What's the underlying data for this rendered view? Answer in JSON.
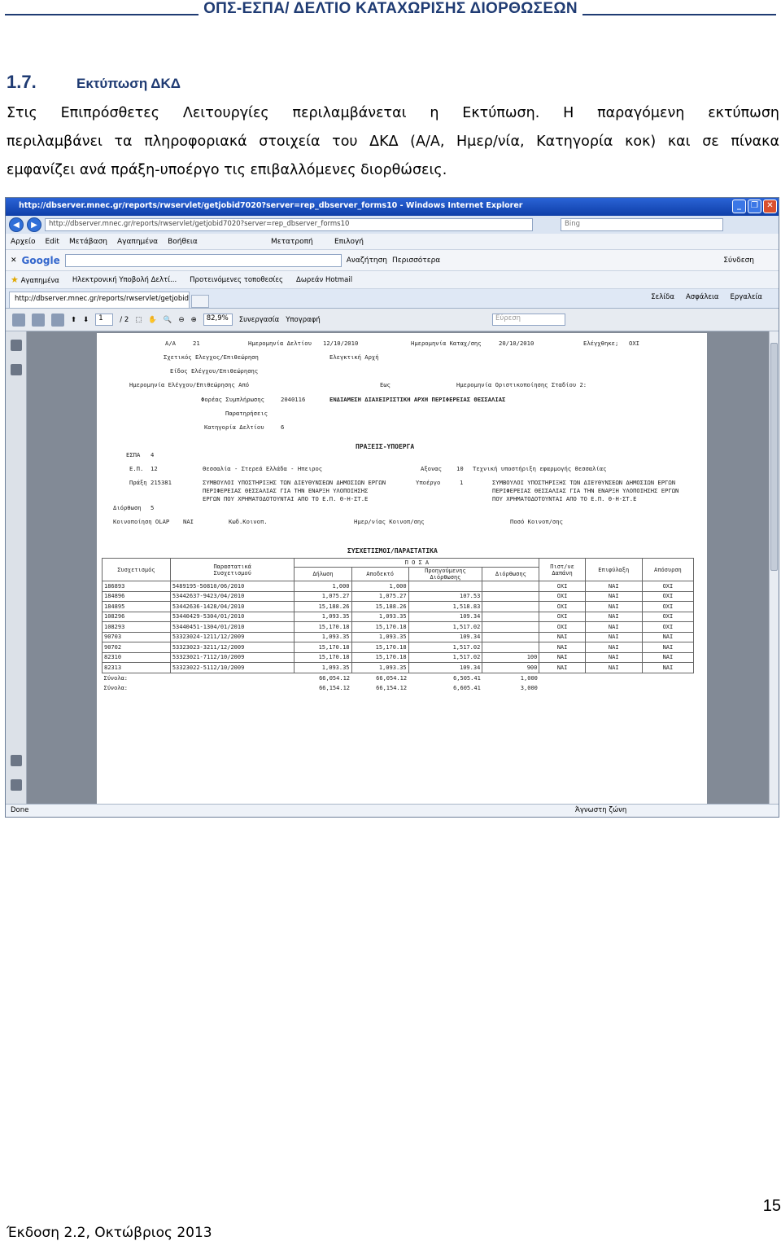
{
  "header": {
    "title": "ΟΠΣ-ΕΣΠΑ/ ΔΕΛΤΙΟ ΚΑΤΑΧΩΡΙΣΗΣ ΔΙΟΡΘΩΣΕΩΝ"
  },
  "section": {
    "number": "1.7.",
    "title": "Εκτύπωση ΔΚΔ"
  },
  "paragraph": {
    "line1": "Στις Επιπρόσθετες Λειτουργίες περιλαμβάνεται η Εκτύπωση. Η παραγόμενη εκτύπωση",
    "line2": "περιλαμβάνει τα πληροφοριακά στοιχεία του ΔΚΔ (Α/Α, Ημερ/νία, Κατηγορία κοκ) και σε πίνακα",
    "line3": "εμφανίζει ανά πράξη-υποέργο τις επιβαλλόμενες διορθώσεις."
  },
  "browser": {
    "window_title": "http://dbserver.mnec.gr/reports/rwservlet/getjobid7020?server=rep_dbserver_forms10 - Windows Internet Explorer",
    "address": "http://dbserver.mnec.gr/reports/rwservlet/getjobid7020?server=rep_dbserver_forms10",
    "search_placeholder": "Bing",
    "menu": [
      "Αρχείο",
      "Edit",
      "Μετάβαση",
      "Αγαπημένα",
      "Βοήθεια"
    ],
    "menu_right": [
      "Μετατροπή",
      "Επιλογή"
    ],
    "google_label": "Google",
    "google_buttons": [
      "Αναζήτηση",
      "Περισσότερα"
    ],
    "google_signin": "Σύνδεση",
    "favorites": [
      "Αγαπημένα",
      "Ηλεκτρονική Υποβολή Δελτί...",
      "Προτεινόμενες τοποθεσίες",
      "Δωρεάν Hotmail"
    ],
    "tab_label": "http://dbserver.mnec.gr/reports/rwservlet/getjobid7...",
    "command_bar": [
      "Σελίδα",
      "Ασφάλεια",
      "Εργαλεία"
    ],
    "pdf_page_current": "1",
    "pdf_page_total": "/ 2",
    "pdf_zoom": "82,9%",
    "pdf_collab": "Συνεργασία",
    "pdf_sign": "Υπογραφή",
    "pdf_find": "Εύρεση",
    "status_left": "Done",
    "status_zone": "Άγνωστη ζώνη"
  },
  "report": {
    "aa_label": "Α/Α",
    "aa_value": "21",
    "date_label": "Ημερομηνία Δελτίου",
    "date_value": "12/10/2010",
    "entry_date_label": "Ημερομηνία Καταχ/σης",
    "entry_date_value": "20/10/2010",
    "checked_label": "Ελέγχθηκε;",
    "checked_value": "ΟΧΙ",
    "related_check_label": "Σχετικός Ελεγχος/Επιθεώρηση",
    "audit_authority_label": "Ελεγκτική Αρχή",
    "check_type_label": "Είδος Ελέγχου/Επιθεώρησης",
    "check_date_label": "Ημερομηνία Ελέγχου/Επιθεώρησης Από",
    "to_label": "Εως",
    "final_date_label": "Ημερομηνία Οριστικοποίησης Σταδίου 2:",
    "body_label": "Φορέας Συμπλήρωσης",
    "body_value": "2040116",
    "body_name": "ΕΝΔΙΑΜΕΣΗ ΔΙΑΧΕΙΡΙΣΤΙΚΗ ΑΡΧΗ ΠΕΡΙΦΕΡΕΙΑΣ ΘΕΣΣΑΛΙΑΣ",
    "remarks_label": "Παρατηρήσεις",
    "category_label": "Κατηγορία Δελτίου",
    "category_value": "6",
    "projects_title": "ΠΡΑΞΕΙΣ-ΥΠΟΕΡΓΑ",
    "espa_label": "ΕΣΠΑ",
    "espa_value": "4",
    "ep_label": "Ε.Π.",
    "ep_value": "12",
    "ep_name": "Θεσσαλία - Στερεά Ελλάδα - Ηπειρος",
    "axis_label": "Αξονας",
    "axis_value": "10",
    "axis_name": "Τεχνική υποστήριξη εφαρμογής Θεσσαλίας",
    "project_label": "Πράξη",
    "project_value": "215381",
    "project_name_1": "ΣΥΜΒΟΥΛΟΙ ΥΠΟΣΤΗΡΙΞΗΣ ΤΩΝ ΔΙΕΥΘΥΝΣΕΩΝ ΔΗΜΟΣΙΩΝ ΕΡΓΩΝ",
    "project_name_2": "ΠΕΡΙΦΕΡΕΙΑΣ ΘΕΣΣΑΛΙΑΣ ΓΙΑ ΤΗΝ ΕΝΑΡΞΗ ΥΛΟΠΟΙΗΣΗΣ",
    "project_name_3": "ΕΡΓΩΝ ΠΟΥ ΧΡΗΜΑΤΟΔΟΤΟΥΝΤΑΙ ΑΠΟ ΤΟ Ε.Π. Θ-Η-ΣΤ.Ε",
    "subproject_label": "Υποέργο",
    "subproject_value": "1",
    "subproject_name_1": "ΣΥΜΒΟΥΛΟΙ ΥΠΟΣΤΗΡΙΞΗΣ ΤΩΝ ΔΙΕΥΘΥΝΣΕΩΝ ΔΗΜΟΣΙΩΝ ΕΡΓΩΝ",
    "subproject_name_2": "ΠΕΡΙΦΕΡΕΙΑΣ ΘΕΣΣΑΛΙΑΣ ΓΙΑ ΤΗΝ ΕΝΑΡΞΗ ΥΛΟΠΟΙΗΣΗΣ ΕΡΓΩΝ",
    "subproject_name_3": "ΠΟΥ ΧΡΗΜΑΤΟΔΟΤΟΥΝΤΑΙ ΑΠΟ ΤΟ Ε.Π. Θ-Η-ΣΤ.Ε",
    "correction_label": "Διόρθωση",
    "correction_value": "5",
    "olap_label": "Κοινοποίηση OLAP",
    "olap_value": "ΝΑΙ",
    "code_label": "Κωδ.Κοινοπ.",
    "notify_date_label": "Ημερ/νίας Κοινοπ/σης",
    "notify_amount_label": "Ποσό Κοινοπ/σης",
    "related_title": "ΣΥΣΧΕΤΙΣΜΟΙ/ΠΑΡΑΣΤΑΤΙΚΑ",
    "table": {
      "headers": {
        "related": "Συσχετισμός",
        "docs_1": "Παραστατικά",
        "docs_2": "Συσχετισμού",
        "amounts": "Π Ο Σ Α",
        "declaration": "Δήλωση",
        "accepted": "Αποδεκτό",
        "previous_1": "Προηγούμενης",
        "previous_2": "Διόρθωσης",
        "correction": "Διόρθωσης",
        "cert_1": "Πιστ/νε",
        "cert_2": "Δαπάνη",
        "reserved": "Επιφύλαξη",
        "withdrawal": "Απόσυρση"
      },
      "rows": [
        [
          "186893",
          "5489195-50810/06/2010",
          "1,000",
          "1,000",
          "",
          "",
          "ΟΧΙ",
          "ΝΑΙ",
          "ΟΧΙ"
        ],
        [
          "184896",
          "53442637-9423/04/2010",
          "1,075.27",
          "1,075.27",
          "107.53",
          "",
          "ΟΧΙ",
          "ΝΑΙ",
          "ΟΧΙ"
        ],
        [
          "184895",
          "53442636-1428/04/2010",
          "15,188.26",
          "15,188.26",
          "1,518.83",
          "",
          "ΟΧΙ",
          "ΝΑΙ",
          "ΟΧΙ"
        ],
        [
          "108296",
          "53440429-5304/01/2010",
          "1,093.35",
          "1,093.35",
          "109.34",
          "",
          "ΟΧΙ",
          "ΝΑΙ",
          "ΟΧΙ"
        ],
        [
          "108293",
          "53440451-1304/01/2010",
          "15,170.18",
          "15,170.18",
          "1,517.02",
          "",
          "ΟΧΙ",
          "ΝΑΙ",
          "ΟΧΙ"
        ],
        [
          "90703",
          "53323024-1211/12/2009",
          "1,093.35",
          "1,093.35",
          "109.34",
          "",
          "ΝΑΙ",
          "ΝΑΙ",
          "ΝΑΙ"
        ],
        [
          "90702",
          "53323023-3211/12/2009",
          "15,170.18",
          "15,170.18",
          "1,517.02",
          "",
          "ΝΑΙ",
          "ΝΑΙ",
          "ΝΑΙ"
        ],
        [
          "82310",
          "53323021-7112/10/2009",
          "15,170.18",
          "15,170.18",
          "1,517.02",
          "100",
          "ΝΑΙ",
          "ΝΑΙ",
          "ΝΑΙ"
        ],
        [
          "82313",
          "53323022-5112/10/2009",
          "1,093.35",
          "1,093.35",
          "109.34",
          "900",
          "ΝΑΙ",
          "ΝΑΙ",
          "ΝΑΙ"
        ]
      ],
      "totals": [
        [
          "Σύνολα:",
          "66,054.12",
          "66,054.12",
          "6,505.41",
          "1,000"
        ],
        [
          "Σύνολα:",
          "66,154.12",
          "66,154.12",
          "6,605.41",
          "3,000"
        ]
      ]
    }
  },
  "footer": {
    "page_number": "15",
    "edition": "Έκδοση 2.2, Οκτώβριος 2013"
  }
}
